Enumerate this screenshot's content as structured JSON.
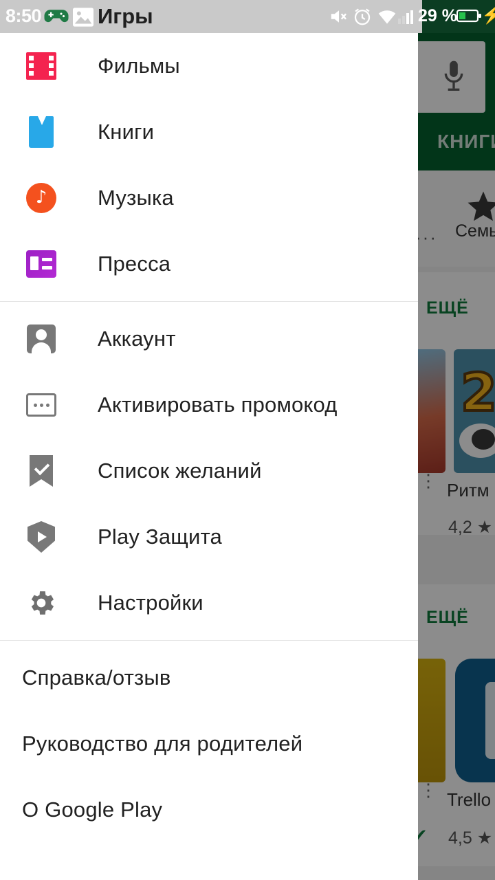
{
  "status_bar": {
    "time": "8:50",
    "title": "Игры",
    "battery_percent": "29 %",
    "icons": {
      "game": "game-controller-icon",
      "image": "image-icon",
      "mute": "volume-mute-icon",
      "alarm": "alarm-clock-icon",
      "wifi": "wifi-icon",
      "signal": "signal-bars-icon",
      "battery": "battery-icon",
      "charging": "charging-bolt-icon"
    },
    "colors": {
      "bar_bg": "#c9c9c9",
      "right_bg": "#0b3d22",
      "battery_fill": "#27c24c"
    }
  },
  "drawer": {
    "groups": [
      {
        "items": [
          {
            "label": "Фильмы",
            "icon": "film-icon"
          },
          {
            "label": "Книги",
            "icon": "book-icon"
          },
          {
            "label": "Музыка",
            "icon": "music-icon"
          },
          {
            "label": "Пресса",
            "icon": "newsstand-icon"
          }
        ]
      },
      {
        "items": [
          {
            "label": "Аккаунт",
            "icon": "account-icon"
          },
          {
            "label": "Активировать промокод",
            "icon": "redeem-icon"
          },
          {
            "label": "Список желаний",
            "icon": "wishlist-bookmark-icon"
          },
          {
            "label": "Play Защита",
            "icon": "play-protect-shield-icon"
          },
          {
            "label": "Настройки",
            "icon": "gear-icon"
          }
        ]
      },
      {
        "items": [
          {
            "label": "Справка/отзыв",
            "icon": ""
          },
          {
            "label": "Руководство для родителей",
            "icon": ""
          },
          {
            "label": "О Google Play",
            "icon": ""
          }
        ]
      }
    ]
  },
  "background_app": {
    "header_color": "#04612f",
    "accent_color": "#0f7a3d",
    "search_mic_icon": "microphone-icon",
    "tabs": [
      {
        "label": "КНИГИ"
      }
    ],
    "family_chip": {
      "label": "Семья",
      "icon": "family-star-icon"
    },
    "sections": [
      {
        "more_label": "ЕЩЁ",
        "app": {
          "title": "Ритм",
          "rating": "4,2 ★"
        }
      },
      {
        "more_label": "ЕЩЁ",
        "app": {
          "title": "Trello",
          "rating": "4,5 ★"
        }
      }
    ]
  }
}
